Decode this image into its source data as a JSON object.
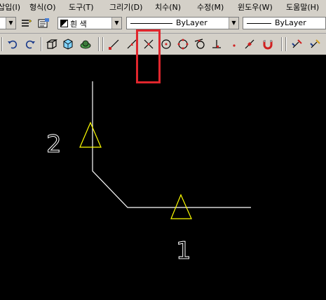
{
  "menu": {
    "items": [
      "삽입(I)",
      "형식(O)",
      "도구(T)",
      "그리기(D)",
      "치수(N)",
      "수정(M)",
      "윈도우(W)",
      "도움말(H)"
    ]
  },
  "properties": {
    "color_value": "흰 색",
    "linetype_value": "ByLayer",
    "lineweight_value": "ByLayer"
  },
  "toolbar": {
    "icons": [
      "undo-icon",
      "redo-icon",
      "box-3d-icon",
      "view-cube-icon",
      "render-icon",
      "snap-endpoint-icon",
      "snap-midpoint-icon",
      "snap-intersection-icon",
      "snap-center-icon",
      "snap-quadrant-icon",
      "snap-tangent-icon",
      "snap-perpendicular-icon",
      "snap-node-icon",
      "snap-nearest-icon",
      "snap-magnet-icon",
      "osnap-settings-icon",
      "snap-none-icon"
    ],
    "highlighted_tool": "snap-intersection-icon"
  },
  "drawing": {
    "label_top": "2",
    "label_bottom": "1",
    "line_color": "#ffffff",
    "marker_color": "#ffff00"
  },
  "colors": {
    "highlight": "#e0262d",
    "canvas_bg": "#000000",
    "chrome": "#d4d0c8"
  }
}
